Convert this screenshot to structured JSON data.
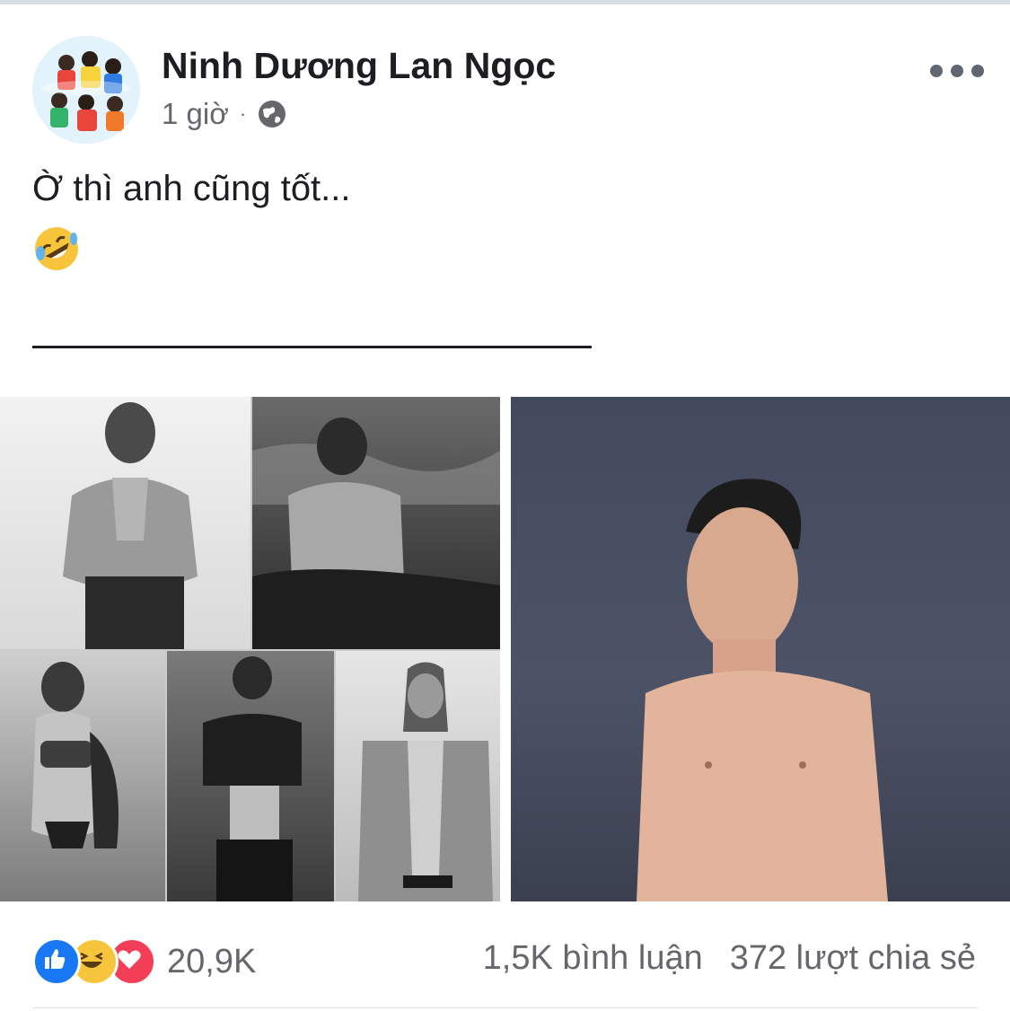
{
  "post": {
    "author": "Ninh Dương Lan Ngọc",
    "time": "1 giờ",
    "separator": "·",
    "privacy_icon": "globe-icon",
    "more_icon": "more-options-icon",
    "text": "Ờ thì anh cũng tốt...",
    "emoji": "rolling-on-floor-laughing-emoji",
    "divider": "________________________"
  },
  "photos": {
    "left_collage": [
      "shirtless man holding shirt",
      "shirtless man on rocks",
      "woman in bikini",
      "man taking mirror selfie",
      "man in open plaid blazer"
    ],
    "right_image": "shirtless man making funny face"
  },
  "footer": {
    "reaction_icons": [
      "like-icon",
      "haha-icon",
      "love-icon"
    ],
    "reaction_count": "20,9K",
    "comments": "1,5K bình luận",
    "shares": "372 lượt chia sẻ"
  },
  "colors": {
    "like": "#1877f2",
    "haha": "#f7c53b",
    "love": "#f33e58",
    "secondary_text": "#65676b"
  }
}
